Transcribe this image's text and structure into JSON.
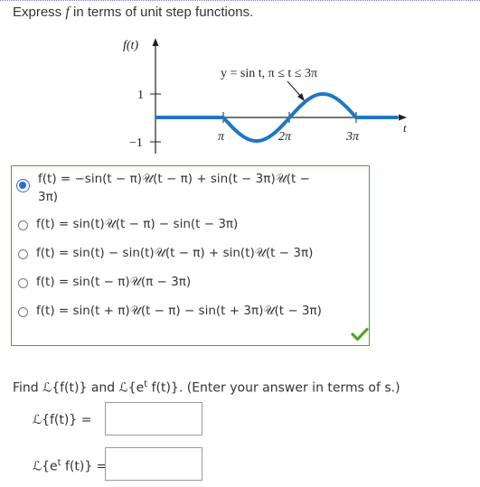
{
  "prompt": {
    "before": "Express ",
    "var": "f",
    "after": " in terms of unit step functions."
  },
  "graph": {
    "y_axis_label": "f(t)",
    "curve_label": "y = sin t,  π ≤ t ≤ 3π",
    "t_label": "t",
    "y_ticks": [
      "1",
      "−1"
    ],
    "x_ticks": [
      "π",
      "2π",
      "3π"
    ],
    "curve_color": "#1f77c4"
  },
  "options": [
    {
      "selected": true,
      "line1": "f(t)  =  −sin(t − π)𝒰(t − π)  +  sin(t − 3π)𝒰(t −",
      "line2": "3π)"
    },
    {
      "selected": false,
      "text": "f(t)  =  sin(t)𝒰(t − π)  −  sin(t − 3π)"
    },
    {
      "selected": false,
      "text": "f(t)  =  sin(t)  −  sin(t)𝒰(t − π)  +  sin(t)𝒰(t − 3π)"
    },
    {
      "selected": false,
      "text": "f(t)  =  sin(t − π)𝒰(π − 3π)"
    },
    {
      "selected": false,
      "text": "f(t)  =  sin(t + π)𝒰(t − π)  −  sin(t + 3π)𝒰(t − 3π)"
    }
  ],
  "correct_mark": "check-icon",
  "find": {
    "text": "Find ℒ{f(t)} and ℒ{e",
    "sup": "t",
    "text2": " f(t)}. (Enter your answer in terms of s.)"
  },
  "answers": [
    {
      "label": "ℒ{f(t)}  =",
      "value": ""
    },
    {
      "label_pre": "ℒ{e",
      "label_sup": "t",
      "label_post": " f(t)}  =",
      "value": ""
    }
  ]
}
